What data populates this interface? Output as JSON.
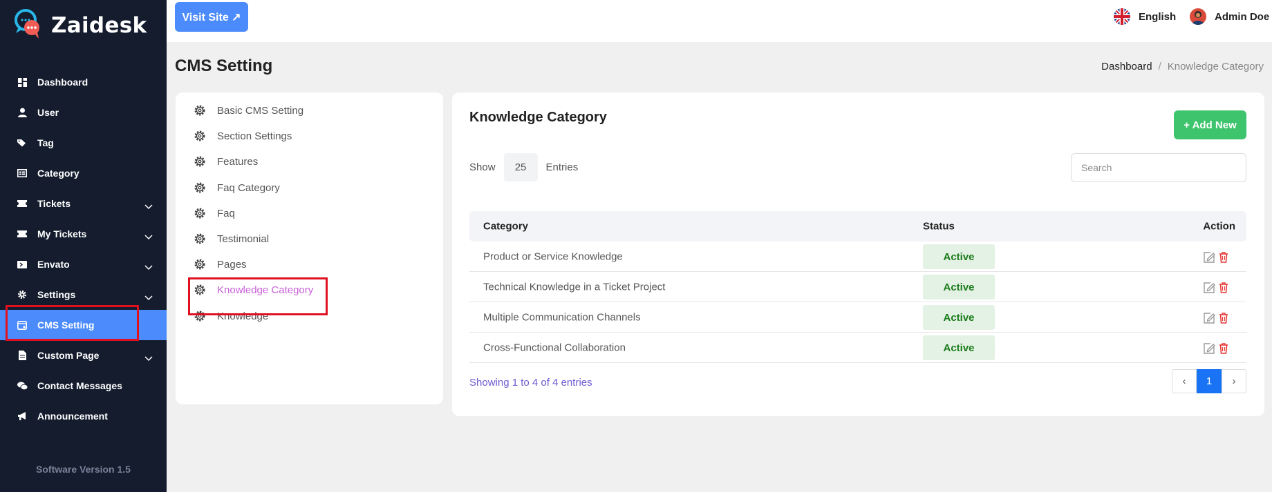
{
  "brand": {
    "name": "Zaidesk"
  },
  "sidebar": {
    "items": [
      {
        "label": "Dashboard",
        "icon": "dashboard-icon",
        "has_caret": false
      },
      {
        "label": "User",
        "icon": "user-icon",
        "has_caret": false
      },
      {
        "label": "Tag",
        "icon": "tag-icon",
        "has_caret": false
      },
      {
        "label": "Category",
        "icon": "category-icon",
        "has_caret": false
      },
      {
        "label": "Tickets",
        "icon": "ticket-icon",
        "has_caret": true
      },
      {
        "label": "My Tickets",
        "icon": "ticket-icon",
        "has_caret": true
      },
      {
        "label": "Envato",
        "icon": "envato-icon",
        "has_caret": true
      },
      {
        "label": "Settings",
        "icon": "gear-icon",
        "has_caret": true
      },
      {
        "label": "CMS Setting",
        "icon": "cms-icon",
        "has_caret": false,
        "active": true
      },
      {
        "label": "Custom Page",
        "icon": "page-icon",
        "has_caret": true
      },
      {
        "label": "Contact Messages",
        "icon": "chat-icon",
        "has_caret": false
      },
      {
        "label": "Announcement",
        "icon": "megaphone-icon",
        "has_caret": false
      }
    ],
    "version": "Software Version 1.5"
  },
  "topbar": {
    "visit_site": "Visit Site ↗",
    "language": "English",
    "user": "Admin Doe"
  },
  "page": {
    "title": "CMS Setting",
    "breadcrumb": {
      "home": "Dashboard",
      "separator": "/",
      "current": "Knowledge Category"
    }
  },
  "cms_menu": {
    "items": [
      {
        "label": "Basic CMS Setting"
      },
      {
        "label": "Section Settings"
      },
      {
        "label": "Features"
      },
      {
        "label": "Faq Category"
      },
      {
        "label": "Faq"
      },
      {
        "label": "Testimonial"
      },
      {
        "label": "Pages"
      },
      {
        "label": "Knowledge Category",
        "active": true
      },
      {
        "label": "Knowledge"
      }
    ]
  },
  "panel": {
    "title": "Knowledge Category",
    "add_new": "+ Add New",
    "show_label": "Show",
    "entries_value": "25",
    "entries_label": "Entries",
    "search_placeholder": "Search",
    "columns": {
      "category": "Category",
      "status": "Status",
      "action": "Action"
    },
    "rows": [
      {
        "category": "Product or Service Knowledge",
        "status": "Active"
      },
      {
        "category": "Technical Knowledge in a Ticket Project",
        "status": "Active"
      },
      {
        "category": "Multiple Communication Channels",
        "status": "Active"
      },
      {
        "category": "Cross-Functional Collaboration",
        "status": "Active"
      }
    ],
    "showing": "Showing 1 to 4 of 4 entries",
    "pagination": {
      "prev": "‹",
      "current": "1",
      "next": "›"
    }
  },
  "colors": {
    "sidebar_bg": "#141c2e",
    "accent": "#4c8bfb",
    "active_menu": "#c960d8",
    "add_button": "#3ec46d",
    "status_text": "#1a7a1a",
    "delete_icon": "#e53935",
    "highlight": "#e01020"
  }
}
